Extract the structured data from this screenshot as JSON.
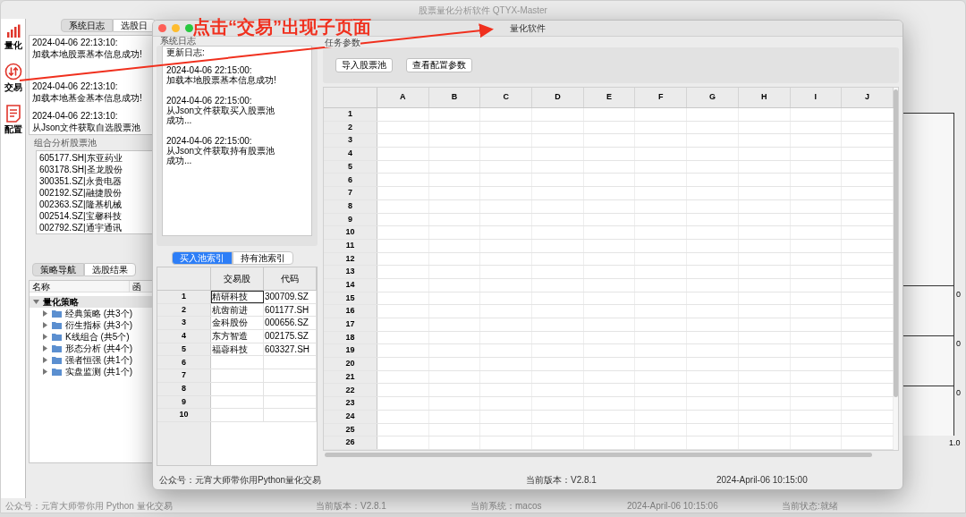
{
  "main_window": {
    "title": "股票量化分析软件 QTYX-Master",
    "sidebar": [
      {
        "label": "量化",
        "kind": "chart"
      },
      {
        "label": "交易",
        "kind": "exchange"
      },
      {
        "label": "配置",
        "kind": "document"
      }
    ],
    "log_tabs": [
      {
        "label": "系统日志",
        "selected": true
      },
      {
        "label": "选股日",
        "selected": false
      }
    ],
    "log": [
      {
        "time": "2024-04-06 22:13:10:",
        "message": "加载本地股票基本信息成功!"
      },
      {
        "time": "2024-04-06 22:13:10:",
        "message": "加载本地基金基本信息成功!"
      },
      {
        "time": "2024-04-06 22:13:10:",
        "message": "从Json文件获取自选股票池"
      }
    ],
    "stock_pool": {
      "title": "组合分析股票池",
      "items": [
        "605177.SH|东亚药业",
        "603178.SH|圣龙股份",
        "300351.SZ|永贵电器",
        "002192.SZ|融捷股份",
        "002363.SZ|隆基机械",
        "002514.SZ|宝馨科技",
        "002792.SZ|通宇通讯"
      ]
    },
    "strategy_tabs": [
      {
        "label": "策略导航",
        "selected": true
      },
      {
        "label": "选股结果",
        "selected": false
      }
    ],
    "tree_columns": [
      "名称",
      "函"
    ],
    "tree": [
      {
        "label": "量化策略",
        "expanded": true,
        "children": [
          {
            "label": "经典策略 (共3个)",
            "expanded": false
          },
          {
            "label": "衍生指标 (共3个)",
            "expanded": false
          },
          {
            "label": "K线组合 (共5个)",
            "expanded": false
          },
          {
            "label": "形态分析 (共4个)",
            "expanded": false
          },
          {
            "label": "强者恒强 (共1个)",
            "expanded": false
          },
          {
            "label": "实盘监测 (共1个)",
            "expanded": false
          }
        ]
      }
    ],
    "chart_labels": [
      "0",
      "0",
      "0",
      "1.0"
    ],
    "status_bar": [
      "公众号：元宵大师带你用 Python 量化交易",
      "当前版本：V2.8.1",
      "当前系统：macos",
      "2024-April-06 10:15:06",
      "当前状态:就绪"
    ]
  },
  "sub_window": {
    "title": "量化软件",
    "log_label": "系统日志",
    "log_header": "更新日志:",
    "log": [
      {
        "time": "2024-04-06 22:15:00:",
        "message": "加载本地股票基本信息成功!"
      },
      {
        "time": "2024-04-06 22:15:00:",
        "message": "从Json文件获取买入股票池成功..."
      },
      {
        "time": "2024-04-06 22:15:00:",
        "message": "从Json文件获取持有股票池成功..."
      }
    ],
    "pool_tabs": [
      {
        "label": "买入池索引",
        "selected": true
      },
      {
        "label": "持有池索引",
        "selected": false
      }
    ],
    "pool_table": {
      "columns": [
        "交易股",
        "代码"
      ],
      "rows": [
        {
          "index": "1",
          "cells": [
            "精研科技",
            "300709.SZ"
          ],
          "selected": true
        },
        {
          "index": "2",
          "cells": [
            "杭齿前进",
            "601177.SH"
          ],
          "selected": false
        },
        {
          "index": "3",
          "cells": [
            "金科股份",
            "000656.SZ"
          ],
          "selected": false
        },
        {
          "index": "4",
          "cells": [
            "东方智造",
            "002175.SZ"
          ],
          "selected": false
        },
        {
          "index": "5",
          "cells": [
            "福蓉科技",
            "603327.SH"
          ],
          "selected": false
        },
        {
          "index": "6",
          "selected": false
        },
        {
          "index": "7",
          "selected": false
        },
        {
          "index": "8",
          "selected": false
        },
        {
          "index": "9",
          "selected": false
        },
        {
          "index": "10",
          "selected": false
        }
      ]
    },
    "task_label": "任务参数",
    "buttons": [
      "导入股票池",
      "查看配置参数"
    ],
    "sheet": {
      "columns": [
        "A",
        "B",
        "C",
        "D",
        "E",
        "F",
        "G",
        "H",
        "I",
        "J"
      ],
      "rows": [
        "1",
        "2",
        "3",
        "4",
        "5",
        "6",
        "7",
        "8",
        "9",
        "10",
        "11",
        "12",
        "13",
        "14",
        "15",
        "16",
        "17",
        "18",
        "19",
        "20",
        "21",
        "22",
        "23",
        "24",
        "25",
        "26"
      ]
    },
    "footer": [
      "公众号：元宵大师带你用Python量化交易",
      "当前版本：V2.8.1",
      "2024-April-06 10:15:00"
    ]
  },
  "annotation": {
    "text": "点击“交易”出现子页面"
  }
}
